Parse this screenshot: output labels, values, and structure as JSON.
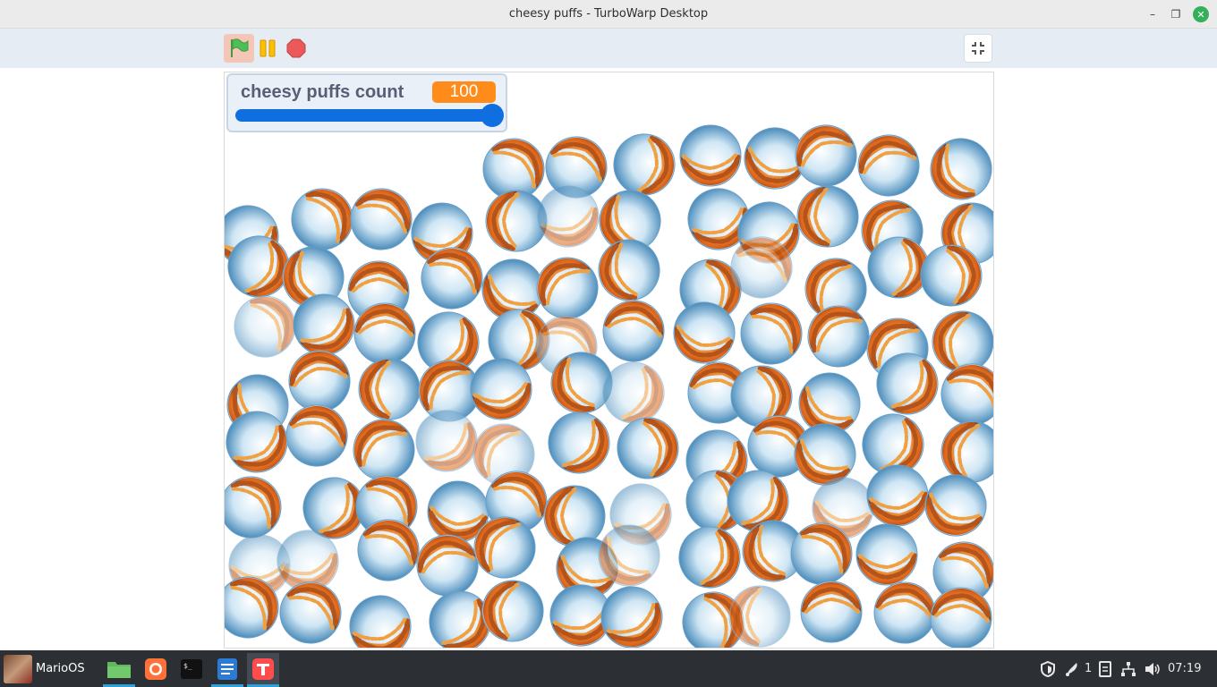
{
  "window": {
    "title": "cheesy puffs - TurboWarp Desktop",
    "min_icon": "–",
    "max_icon": "❐",
    "close_icon": "✕"
  },
  "toolbar": {
    "green_flag": "green-flag-icon",
    "pause": "pause-icon",
    "stop": "stop-icon",
    "exit_fullscreen": "exit-fullscreen-icon"
  },
  "monitor": {
    "label": "cheesy puffs count",
    "value": "100",
    "slider_fraction": 1.0
  },
  "stage": {
    "sprite_name": "cheesy-puffs-bowl",
    "accent_blue": "#0f6fe0",
    "monitor_orange": "#ff8c1a"
  },
  "taskbar": {
    "start_label": "MarioOS",
    "apps": [
      {
        "name": "files",
        "active": false
      },
      {
        "name": "firefox",
        "active": false
      },
      {
        "name": "terminal",
        "active": false
      },
      {
        "name": "text-editor",
        "active": false
      },
      {
        "name": "turbowarp",
        "active": true
      }
    ],
    "notifications_count": "1",
    "clock": "07:19"
  }
}
